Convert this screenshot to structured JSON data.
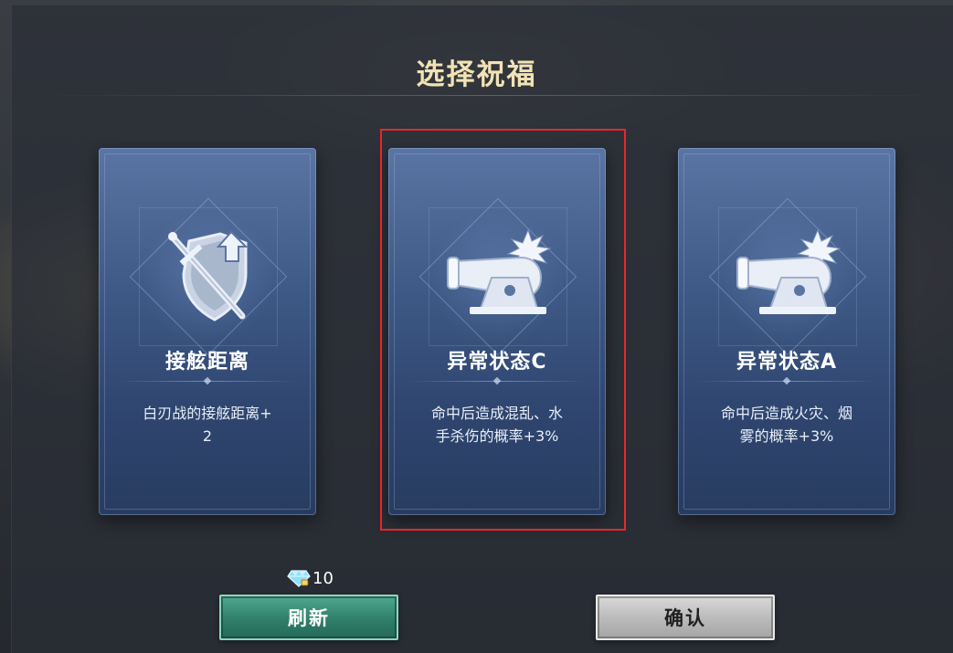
{
  "screen": {
    "title": "选择祝福"
  },
  "cards": [
    {
      "name": "接舷距离",
      "desc_line1": "白刃战的接舷距离+",
      "desc_line2": "2",
      "icon": "sword-shield-icon"
    },
    {
      "name": "异常状态C",
      "desc_line1": "命中后造成混乱、水",
      "desc_line2": "手杀伤的概率+3%",
      "icon": "cannon-icon",
      "selected": true
    },
    {
      "name": "异常状态A",
      "desc_line1": "命中后造成火灾、烟",
      "desc_line2": "雾的概率+3%",
      "icon": "cannon-icon"
    }
  ],
  "refresh": {
    "cost": "10",
    "currency_icon": "diamond-icon",
    "label": "刷新"
  },
  "confirm": {
    "label": "确认"
  },
  "colors": {
    "title": "#f2e3b4",
    "selection_border": "#e8262c",
    "refresh_button": "#2f7f69",
    "confirm_button": "#b9b9b9"
  }
}
